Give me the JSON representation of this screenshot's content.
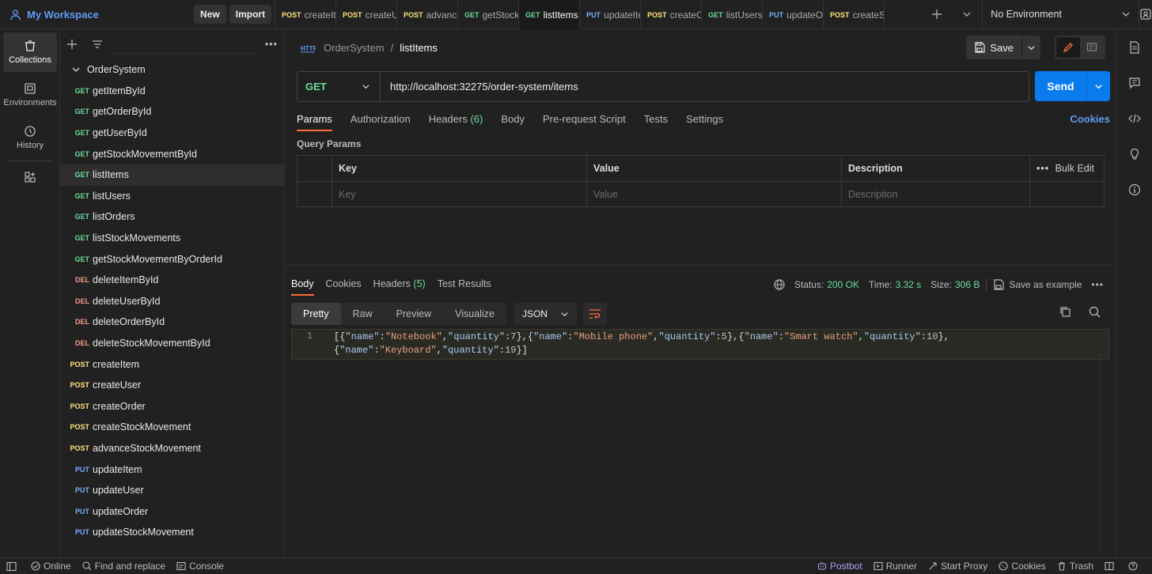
{
  "workspace": {
    "title": "My Workspace",
    "new_label": "New",
    "import_label": "Import"
  },
  "tabs": [
    {
      "method": "POST",
      "label": "createItem",
      "active": false
    },
    {
      "method": "POST",
      "label": "createUser",
      "active": false
    },
    {
      "method": "POST",
      "label": "advanceStockMovement",
      "active": false
    },
    {
      "method": "GET",
      "label": "getStockMovementById",
      "active": false
    },
    {
      "method": "GET",
      "label": "listItems",
      "active": true,
      "unsaved": true
    },
    {
      "method": "PUT",
      "label": "updateItem",
      "active": false
    },
    {
      "method": "POST",
      "label": "createOrder",
      "active": false
    },
    {
      "method": "GET",
      "label": "listUsers",
      "active": false
    },
    {
      "method": "PUT",
      "label": "updateOrder",
      "active": false
    },
    {
      "method": "POST",
      "label": "createStockMovement",
      "active": false
    }
  ],
  "environment": {
    "selected": "No Environment"
  },
  "rail": [
    {
      "label": "Collections",
      "icon": "collections-icon",
      "active": true
    },
    {
      "label": "Environments",
      "icon": "environments-icon",
      "active": false
    },
    {
      "label": "History",
      "icon": "history-icon",
      "active": false
    }
  ],
  "collection": {
    "name": "OrderSystem",
    "requests": [
      {
        "method": "GET",
        "name": "getItemById"
      },
      {
        "method": "GET",
        "name": "getOrderById"
      },
      {
        "method": "GET",
        "name": "getUserById"
      },
      {
        "method": "GET",
        "name": "getStockMovementById"
      },
      {
        "method": "GET",
        "name": "listItems",
        "selected": true
      },
      {
        "method": "GET",
        "name": "listUsers"
      },
      {
        "method": "GET",
        "name": "listOrders"
      },
      {
        "method": "GET",
        "name": "listStockMovements"
      },
      {
        "method": "GET",
        "name": "getStockMovementByOrderId"
      },
      {
        "method": "DEL",
        "name": "deleteItemById"
      },
      {
        "method": "DEL",
        "name": "deleteUserById"
      },
      {
        "method": "DEL",
        "name": "deleteOrderById"
      },
      {
        "method": "DEL",
        "name": "deleteStockMovementById"
      },
      {
        "method": "POST",
        "name": "createItem"
      },
      {
        "method": "POST",
        "name": "createUser"
      },
      {
        "method": "POST",
        "name": "createOrder"
      },
      {
        "method": "POST",
        "name": "createStockMovement"
      },
      {
        "method": "POST",
        "name": "advanceStockMovement"
      },
      {
        "method": "PUT",
        "name": "updateItem"
      },
      {
        "method": "PUT",
        "name": "updateUser"
      },
      {
        "method": "PUT",
        "name": "updateOrder"
      },
      {
        "method": "PUT",
        "name": "updateStockMovement"
      }
    ]
  },
  "request": {
    "breadcrumb_parent": "OrderSystem",
    "breadcrumb_sep": "/",
    "breadcrumb_current": "listItems",
    "save_label": "Save",
    "method": "GET",
    "url": "http://localhost:32275/order-system/items",
    "send_label": "Send",
    "tabs": [
      {
        "label": "Params",
        "active": true
      },
      {
        "label": "Authorization"
      },
      {
        "label": "Headers",
        "count": "(6)"
      },
      {
        "label": "Body"
      },
      {
        "label": "Pre-request Script"
      },
      {
        "label": "Tests"
      },
      {
        "label": "Settings"
      }
    ],
    "cookies_label": "Cookies",
    "query_params_title": "Query Params",
    "table": {
      "headers": [
        "Key",
        "Value",
        "Description"
      ],
      "placeholders": [
        "Key",
        "Value",
        "Description"
      ],
      "bulk_edit_label": "Bulk Edit"
    }
  },
  "response": {
    "tabs": [
      {
        "label": "Body",
        "active": true
      },
      {
        "label": "Cookies"
      },
      {
        "label": "Headers",
        "count": "(5)"
      },
      {
        "label": "Test Results"
      }
    ],
    "status_label": "Status:",
    "status_value": "200 OK",
    "time_label": "Time:",
    "time_value": "3.32 s",
    "size_label": "Size:",
    "size_value": "306 B",
    "save_example_label": "Save as example",
    "views": [
      "Pretty",
      "Raw",
      "Preview",
      "Visualize"
    ],
    "active_view": "Pretty",
    "format": "JSON",
    "line_number": "1",
    "items": [
      {
        "name": "Notebook",
        "quantity": 7
      },
      {
        "name": "Mobile phone",
        "quantity": 5
      },
      {
        "name": "Smart watch",
        "quantity": 10
      },
      {
        "name": "Keyboard",
        "quantity": 19
      }
    ]
  },
  "statusbar": {
    "online": "Online",
    "find_replace": "Find and replace",
    "console": "Console",
    "postbot": "Postbot",
    "runner": "Runner",
    "start_proxy": "Start Proxy",
    "cookies": "Cookies",
    "trash": "Trash"
  },
  "colors": {
    "accent": "#ff6c37",
    "send": "#097bed",
    "link": "#5f9cf6",
    "get": "#6bdd9a",
    "post": "#ffe47e",
    "put": "#74aef6",
    "delete": "#f79a8e"
  }
}
